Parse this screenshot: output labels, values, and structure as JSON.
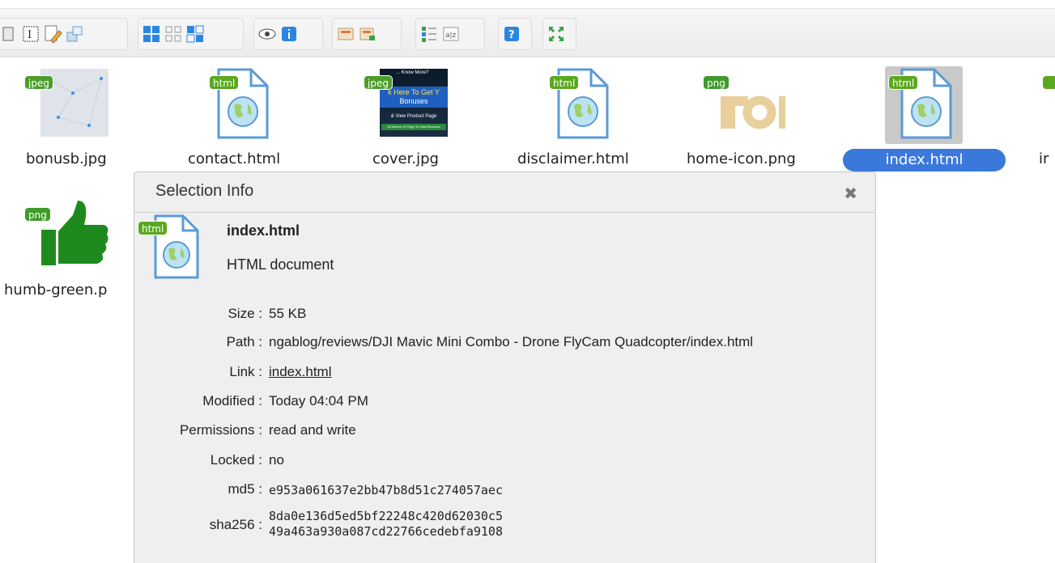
{
  "toolbar": {
    "icons": [
      "copy-icon",
      "rename-icon",
      "edit-icon",
      "resize-icon",
      "icons-view-icon",
      "grid-view-icon",
      "list-view-icon",
      "preview-icon",
      "info-icon",
      "archive-icon",
      "extract-icon",
      "sort-icon",
      "sort-az-icon",
      "help-icon",
      "fullscreen-icon"
    ]
  },
  "files": [
    {
      "name": "bonusb.jpg",
      "type": "jpeg"
    },
    {
      "name": "contact.html",
      "type": "html"
    },
    {
      "name": "cover.jpg",
      "type": "jpeg"
    },
    {
      "name": "disclaimer.html",
      "type": "html"
    },
    {
      "name": "home-icon.png",
      "type": "png"
    },
    {
      "name": "index.html",
      "type": "html"
    },
    {
      "name": "ir",
      "type": ""
    },
    {
      "name": "humb-green.p",
      "type": "png"
    }
  ],
  "cover_text": {
    "line1": "... Know More?",
    "line2": "k Here To Get Y",
    "line3": "Bonuses",
    "line4": "& View Product Page",
    "line5": "At Bottom Of Page To View Bonuses"
  },
  "dialog": {
    "title": "Selection Info",
    "close": "✖",
    "badge": "html",
    "name": "index.html",
    "kind": "HTML document",
    "rows": [
      {
        "label": "Size :",
        "value": "55 KB"
      },
      {
        "label": "Path :",
        "value": "ngablog/reviews/DJI Mavic Mini Combo - Drone FlyCam Quadcopter/index.html"
      },
      {
        "label": "Link :",
        "value": "index.html"
      },
      {
        "label": "Modified :",
        "value": "Today 04:04 PM"
      },
      {
        "label": "Permissions :",
        "value": "read and write"
      },
      {
        "label": "Locked :",
        "value": "no"
      },
      {
        "label": "md5 :",
        "value": "e953a061637e2bb47b8d51c274057aec"
      },
      {
        "label": "sha256 :",
        "value": "8da0e136d5ed5bf22248c420d62030c5",
        "value2": "49a463a930a087cd22766cedebfa9108"
      }
    ]
  },
  "colors": {
    "selection": "#3a78dc",
    "badge_green": "#5aa81e",
    "thumb_green": "#1e8a1e"
  }
}
